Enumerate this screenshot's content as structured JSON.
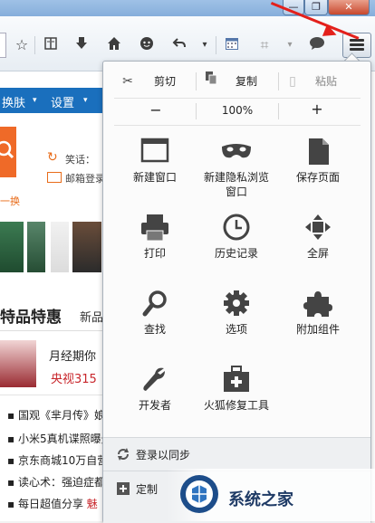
{
  "window": {
    "close_glyph": "✕",
    "max_glyph": "❐",
    "min_glyph": "—"
  },
  "toolbar": {
    "icons": [
      "star-icon",
      "reading-list-icon",
      "download-icon",
      "home-icon",
      "chat-icon",
      "back-icon",
      "dropdown-icon",
      "calendar-icon",
      "crop-icon",
      "speech-icon",
      "hamburger-menu-icon"
    ]
  },
  "page": {
    "nav": [
      "换肤",
      "设置"
    ],
    "side_lines": [
      "笑话：",
      "邮箱登录"
    ],
    "change": "一换",
    "heading": "特品特惠",
    "new_tab": "新品",
    "promo_1": "月经期你",
    "promo_2": "央视315",
    "list": [
      "国观《芈月传》娘",
      "小米5真机谍照曝光",
      "京东商城10万自营",
      "读心术：强迫症都",
      "每日超值分享"
    ],
    "list_tail": "魅"
  },
  "menu": {
    "edit": {
      "cut": "剪切",
      "copy": "复制",
      "paste": "粘贴"
    },
    "zoom": {
      "out": "−",
      "value": "100%",
      "in": "+"
    },
    "items": [
      {
        "id": "new-window",
        "label": "新建窗口",
        "icon": "new-window-icon"
      },
      {
        "id": "private-window",
        "label": "新建隐私浏览\n窗口",
        "icon": "mask-icon"
      },
      {
        "id": "save-page",
        "label": "保存页面",
        "icon": "document-icon"
      },
      {
        "id": "print",
        "label": "打印",
        "icon": "printer-icon"
      },
      {
        "id": "history",
        "label": "历史记录",
        "icon": "clock-icon"
      },
      {
        "id": "fullscreen",
        "label": "全屏",
        "icon": "fullscreen-arrows-icon"
      },
      {
        "id": "find",
        "label": "查找",
        "icon": "magnifier-icon"
      },
      {
        "id": "options",
        "label": "选项",
        "icon": "gear-icon"
      },
      {
        "id": "addons",
        "label": "附加组件",
        "icon": "puzzle-icon"
      },
      {
        "id": "developer",
        "label": "开发者",
        "icon": "wrench-icon"
      },
      {
        "id": "repair",
        "label": "火狐修复工具",
        "icon": "toolbox-icon"
      }
    ],
    "sync": "登录以同步",
    "customize": "定制"
  },
  "watermark": {
    "text": "系统之家",
    "logo_text": "系统之家"
  },
  "colors": {
    "accent": "#1a6fbd",
    "arrow": "#e3201b",
    "brand_orange": "#ef6a28"
  }
}
